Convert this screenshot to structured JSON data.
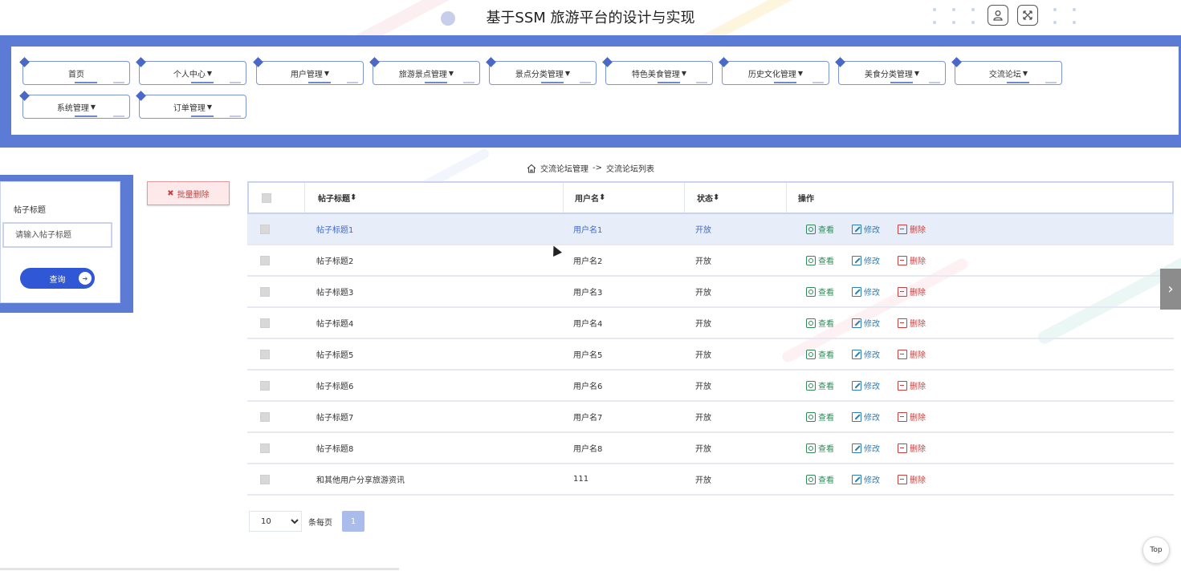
{
  "app": {
    "title": "基于SSM 旅游平台的设计与实现"
  },
  "header": {
    "icons": [
      "user-icon",
      "fullscreen-icon"
    ]
  },
  "nav": {
    "items": [
      {
        "label": "首页",
        "dropdown": false
      },
      {
        "label": "个人中心",
        "dropdown": true
      },
      {
        "label": "用户管理",
        "dropdown": true
      },
      {
        "label": "旅游景点管理",
        "dropdown": true
      },
      {
        "label": "景点分类管理",
        "dropdown": true
      },
      {
        "label": "特色美食管理",
        "dropdown": true
      },
      {
        "label": "历史文化管理",
        "dropdown": true
      },
      {
        "label": "美食分类管理",
        "dropdown": true
      },
      {
        "label": "交流论坛",
        "dropdown": true
      },
      {
        "label": "系统管理",
        "dropdown": true
      },
      {
        "label": "订单管理",
        "dropdown": true
      }
    ]
  },
  "search": {
    "label": "帖子标题",
    "placeholder": "请输入帖子标题",
    "button": "查询"
  },
  "batch_delete": "批量删除",
  "breadcrumb": {
    "section": "交流论坛管理",
    "separator": "->",
    "page": "交流论坛列表"
  },
  "table": {
    "columns": [
      "帖子标题",
      "用户名",
      "状态",
      "操作"
    ],
    "actions": {
      "view": "查看",
      "edit": "修改",
      "delete": "删除"
    },
    "rows": [
      {
        "title": "帖子标题1",
        "user": "用户名1",
        "status": "开放",
        "selected": true
      },
      {
        "title": "帖子标题2",
        "user": "用户名2",
        "status": "开放",
        "selected": false
      },
      {
        "title": "帖子标题3",
        "user": "用户名3",
        "status": "开放",
        "selected": false
      },
      {
        "title": "帖子标题4",
        "user": "用户名4",
        "status": "开放",
        "selected": false
      },
      {
        "title": "帖子标题5",
        "user": "用户名5",
        "status": "开放",
        "selected": false
      },
      {
        "title": "帖子标题6",
        "user": "用户名6",
        "status": "开放",
        "selected": false
      },
      {
        "title": "帖子标题7",
        "user": "用户名7",
        "status": "开放",
        "selected": false
      },
      {
        "title": "帖子标题8",
        "user": "用户名8",
        "status": "开放",
        "selected": false
      },
      {
        "title": "和其他用户分享旅游资讯",
        "user": "111",
        "status": "开放",
        "selected": false
      }
    ]
  },
  "pagination": {
    "page_size": "10",
    "per_page_label": "条每页",
    "current_page": "1"
  },
  "top_button": "Top",
  "colors": {
    "primary": "#5b7bd5",
    "button": "#3057d5",
    "danger": "#c84040",
    "view": "#2e8b57",
    "edit": "#2e7db5"
  }
}
